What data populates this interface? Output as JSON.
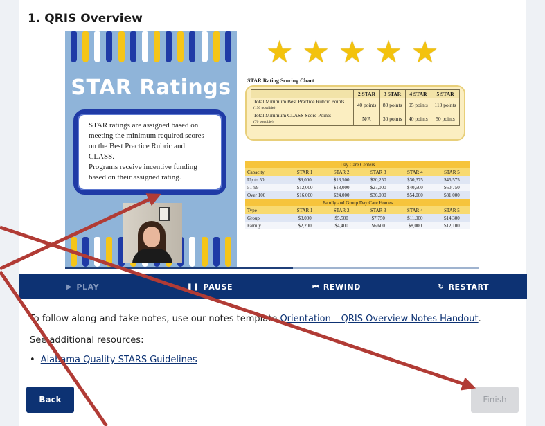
{
  "section": {
    "title": "1. QRIS Overview"
  },
  "slide": {
    "heading": "STAR Ratings",
    "body_lines": [
      "STAR ratings are assigned based on",
      "meeting the minimum required scores",
      "on the Best Practice Rubric and",
      "CLASS.",
      "Programs receive incentive funding",
      "based on their assigned rating."
    ],
    "star_glyph": "★",
    "scoring_chart": {
      "title": "STAR Rating Scoring Chart",
      "headers": [
        "",
        "2 STAR",
        "3 STAR",
        "4 STAR",
        "5 STAR"
      ],
      "rows": [
        {
          "label_main": "Total Minimum Best Practice Rubric Points",
          "label_note": "(130 possible)",
          "values": [
            "40 points",
            "80 points",
            "95 points",
            "110 points"
          ]
        },
        {
          "label_main": "Total Minimum CLASS Score Points",
          "label_note": "(70 possible)",
          "values": [
            "N/A",
            "30 points",
            "40 points",
            "50 points"
          ]
        }
      ]
    },
    "funding_table": {
      "day_care_title": "Day Care Centers",
      "day_care_headers": [
        "Capacity",
        "STAR 1",
        "STAR 2",
        "STAR 3",
        "STAR 4",
        "STAR 5"
      ],
      "day_care_rows": [
        [
          "Up to 50",
          "$9,000",
          "$13,500",
          "$20,250",
          "$30,375",
          "$45,575"
        ],
        [
          "51-99",
          "$12,000",
          "$18,000",
          "$27,000",
          "$40,500",
          "$60,750"
        ],
        [
          "Over 100",
          "$16,000",
          "$24,000",
          "$36,000",
          "$54,000",
          "$81,000"
        ]
      ],
      "homes_title": "Family and Group Day Care Homes",
      "homes_headers": [
        "Type",
        "STAR 1",
        "STAR 2",
        "STAR 3",
        "STAR 4",
        "STAR 5"
      ],
      "homes_rows": [
        [
          "Group",
          "$3,000",
          "$5,500",
          "$7,750",
          "$11,000",
          "$14,300"
        ],
        [
          "Family",
          "$2,200",
          "$4,400",
          "$6,600",
          "$8,000",
          "$12,100"
        ]
      ]
    },
    "progress_fraction": 0.55
  },
  "controls": {
    "play": {
      "label": "PLAY",
      "icon": "play-icon",
      "glyph": "▶"
    },
    "pause": {
      "label": "PAUSE",
      "icon": "pause-icon",
      "glyph": "❚❚"
    },
    "rewind": {
      "label": "REWIND",
      "icon": "rewind-icon",
      "glyph": "⏮"
    },
    "restart": {
      "label": "RESTART",
      "icon": "restart-icon",
      "glyph": "↻"
    }
  },
  "content": {
    "intro_prefix": "To follow along and take notes, use our notes template ",
    "notes_link": "Orientation – QRIS Overview Notes Handout",
    "intro_suffix": ".",
    "resources_label": "See additional resources:",
    "bullet": "•",
    "resource_link": "Alabama Quality STARS Guidelines"
  },
  "footer": {
    "back_label": "Back",
    "finish_label": "Finish"
  },
  "colors": {
    "navy": "#0d3273",
    "star_gold": "#f3c20d",
    "slide_blue": "#8fb4d9",
    "annotation_arrow": "#b13b35",
    "finish_disabled_bg": "#d9dadd"
  }
}
